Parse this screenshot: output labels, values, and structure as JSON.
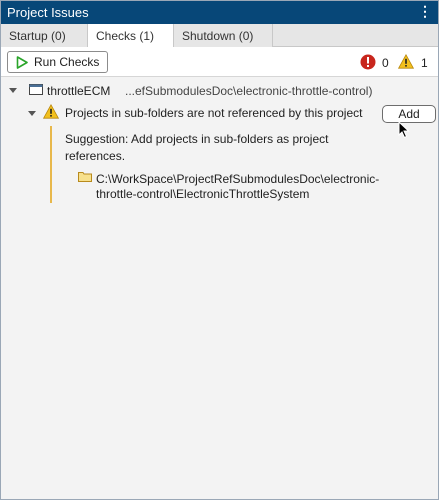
{
  "window": {
    "title": "Project Issues",
    "menu_glyph": "⋮"
  },
  "tabs": [
    {
      "label": "Startup (0)",
      "active": false
    },
    {
      "label": "Checks (1)",
      "active": true
    },
    {
      "label": "Shutdown (0)",
      "active": false
    }
  ],
  "toolbar": {
    "run_label": "Run Checks",
    "error_count": "0",
    "warning_count": "1"
  },
  "tree": {
    "project_name": "throttleECM",
    "project_path": "...efSubmodulesDoc\\electronic-throttle-control)",
    "issue": {
      "text": "Projects in sub-folders are not referenced by this project",
      "action_label": "Add",
      "suggestion_line1": "Suggestion: Add projects in sub-folders as project",
      "suggestion_line2": "references.",
      "folder_line1": "C:\\WorkSpace\\ProjectRefSubmodulesDoc\\electronic-",
      "folder_line2": "throttle-control\\ElectronicThrottleSystem"
    }
  },
  "colors": {
    "title_bar": "#074778",
    "run_icon": "#2aa52a",
    "error": "#c8261d",
    "warning": "#f2c01e",
    "suggestion_bar": "#e8b84b"
  }
}
